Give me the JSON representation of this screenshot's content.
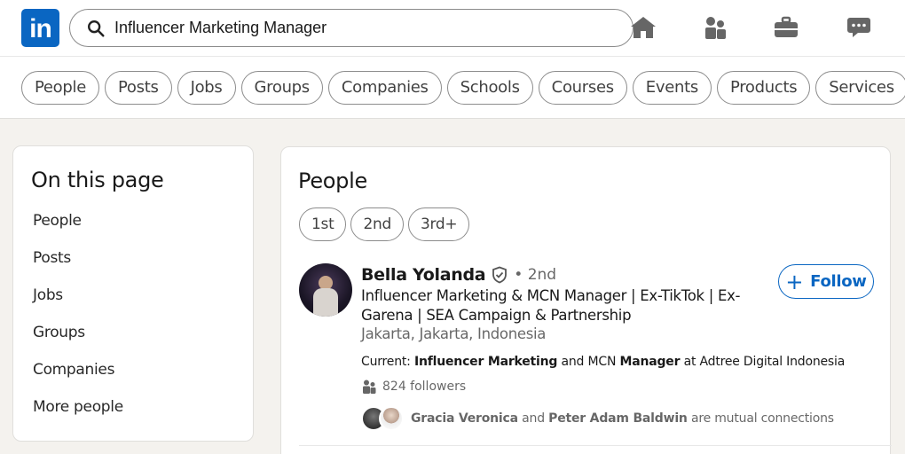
{
  "header": {
    "logo": "in",
    "search": {
      "value": "Influencer Marketing Manager",
      "icon": "search-icon"
    },
    "nav_icons": [
      "home-icon",
      "my-network-icon",
      "jobs-icon",
      "messaging-icon"
    ]
  },
  "filters": [
    "People",
    "Posts",
    "Jobs",
    "Groups",
    "Companies",
    "Schools",
    "Courses",
    "Events",
    "Products",
    "Services"
  ],
  "on_this_page": {
    "title": "On this page",
    "items": [
      "People",
      "Posts",
      "Jobs",
      "Groups",
      "Companies",
      "More people"
    ]
  },
  "people": {
    "title": "People",
    "connection_filters": [
      "1st",
      "2nd",
      "3rd+"
    ],
    "result": {
      "name": "Bella Yolanda",
      "degree": "• 2nd",
      "headline": "Influencer Marketing & MCN Manager | Ex-TikTok | Ex-Garena | SEA Campaign & Partnership",
      "location": "Jakarta, Jakarta, Indonesia",
      "current_label": "Current:",
      "current_kw1": "Influencer Marketing",
      "current_mid": "and MCN",
      "current_kw2": "Manager",
      "current_rest": "at Adtree Digital Indonesia",
      "followers": "824 followers",
      "mutual_1": "Gracia Veronica",
      "mutual_and": "and",
      "mutual_2": "Peter Adam Baldwin",
      "mutual_suffix": "are mutual connections",
      "follow_plus": "+",
      "follow_label": "Follow"
    }
  },
  "colors": {
    "brand": "#0a66c2",
    "background": "#f4f2ee",
    "card": "#ffffff"
  }
}
